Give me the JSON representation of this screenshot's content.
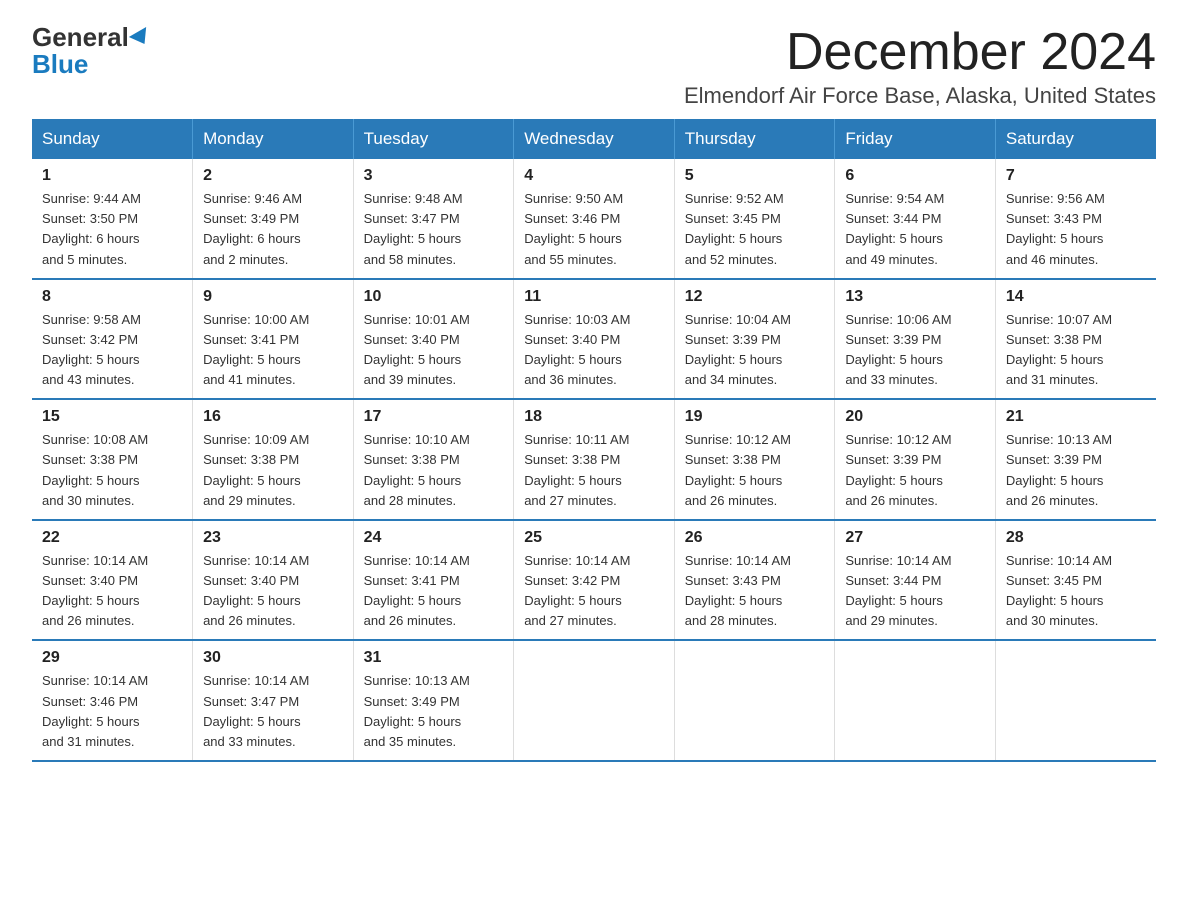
{
  "logo": {
    "general": "General",
    "blue": "Blue"
  },
  "title": "December 2024",
  "location": "Elmendorf Air Force Base, Alaska, United States",
  "weekdays": [
    "Sunday",
    "Monday",
    "Tuesday",
    "Wednesday",
    "Thursday",
    "Friday",
    "Saturday"
  ],
  "weeks": [
    [
      {
        "day": "1",
        "sunrise": "9:44 AM",
        "sunset": "3:50 PM",
        "daylight": "6 hours and 5 minutes."
      },
      {
        "day": "2",
        "sunrise": "9:46 AM",
        "sunset": "3:49 PM",
        "daylight": "6 hours and 2 minutes."
      },
      {
        "day": "3",
        "sunrise": "9:48 AM",
        "sunset": "3:47 PM",
        "daylight": "5 hours and 58 minutes."
      },
      {
        "day": "4",
        "sunrise": "9:50 AM",
        "sunset": "3:46 PM",
        "daylight": "5 hours and 55 minutes."
      },
      {
        "day": "5",
        "sunrise": "9:52 AM",
        "sunset": "3:45 PM",
        "daylight": "5 hours and 52 minutes."
      },
      {
        "day": "6",
        "sunrise": "9:54 AM",
        "sunset": "3:44 PM",
        "daylight": "5 hours and 49 minutes."
      },
      {
        "day": "7",
        "sunrise": "9:56 AM",
        "sunset": "3:43 PM",
        "daylight": "5 hours and 46 minutes."
      }
    ],
    [
      {
        "day": "8",
        "sunrise": "9:58 AM",
        "sunset": "3:42 PM",
        "daylight": "5 hours and 43 minutes."
      },
      {
        "day": "9",
        "sunrise": "10:00 AM",
        "sunset": "3:41 PM",
        "daylight": "5 hours and 41 minutes."
      },
      {
        "day": "10",
        "sunrise": "10:01 AM",
        "sunset": "3:40 PM",
        "daylight": "5 hours and 39 minutes."
      },
      {
        "day": "11",
        "sunrise": "10:03 AM",
        "sunset": "3:40 PM",
        "daylight": "5 hours and 36 minutes."
      },
      {
        "day": "12",
        "sunrise": "10:04 AM",
        "sunset": "3:39 PM",
        "daylight": "5 hours and 34 minutes."
      },
      {
        "day": "13",
        "sunrise": "10:06 AM",
        "sunset": "3:39 PM",
        "daylight": "5 hours and 33 minutes."
      },
      {
        "day": "14",
        "sunrise": "10:07 AM",
        "sunset": "3:38 PM",
        "daylight": "5 hours and 31 minutes."
      }
    ],
    [
      {
        "day": "15",
        "sunrise": "10:08 AM",
        "sunset": "3:38 PM",
        "daylight": "5 hours and 30 minutes."
      },
      {
        "day": "16",
        "sunrise": "10:09 AM",
        "sunset": "3:38 PM",
        "daylight": "5 hours and 29 minutes."
      },
      {
        "day": "17",
        "sunrise": "10:10 AM",
        "sunset": "3:38 PM",
        "daylight": "5 hours and 28 minutes."
      },
      {
        "day": "18",
        "sunrise": "10:11 AM",
        "sunset": "3:38 PM",
        "daylight": "5 hours and 27 minutes."
      },
      {
        "day": "19",
        "sunrise": "10:12 AM",
        "sunset": "3:38 PM",
        "daylight": "5 hours and 26 minutes."
      },
      {
        "day": "20",
        "sunrise": "10:12 AM",
        "sunset": "3:39 PM",
        "daylight": "5 hours and 26 minutes."
      },
      {
        "day": "21",
        "sunrise": "10:13 AM",
        "sunset": "3:39 PM",
        "daylight": "5 hours and 26 minutes."
      }
    ],
    [
      {
        "day": "22",
        "sunrise": "10:14 AM",
        "sunset": "3:40 PM",
        "daylight": "5 hours and 26 minutes."
      },
      {
        "day": "23",
        "sunrise": "10:14 AM",
        "sunset": "3:40 PM",
        "daylight": "5 hours and 26 minutes."
      },
      {
        "day": "24",
        "sunrise": "10:14 AM",
        "sunset": "3:41 PM",
        "daylight": "5 hours and 26 minutes."
      },
      {
        "day": "25",
        "sunrise": "10:14 AM",
        "sunset": "3:42 PM",
        "daylight": "5 hours and 27 minutes."
      },
      {
        "day": "26",
        "sunrise": "10:14 AM",
        "sunset": "3:43 PM",
        "daylight": "5 hours and 28 minutes."
      },
      {
        "day": "27",
        "sunrise": "10:14 AM",
        "sunset": "3:44 PM",
        "daylight": "5 hours and 29 minutes."
      },
      {
        "day": "28",
        "sunrise": "10:14 AM",
        "sunset": "3:45 PM",
        "daylight": "5 hours and 30 minutes."
      }
    ],
    [
      {
        "day": "29",
        "sunrise": "10:14 AM",
        "sunset": "3:46 PM",
        "daylight": "5 hours and 31 minutes."
      },
      {
        "day": "30",
        "sunrise": "10:14 AM",
        "sunset": "3:47 PM",
        "daylight": "5 hours and 33 minutes."
      },
      {
        "day": "31",
        "sunrise": "10:13 AM",
        "sunset": "3:49 PM",
        "daylight": "5 hours and 35 minutes."
      },
      null,
      null,
      null,
      null
    ]
  ],
  "labels": {
    "sunrise": "Sunrise: ",
    "sunset": "Sunset: ",
    "daylight": "Daylight: "
  }
}
